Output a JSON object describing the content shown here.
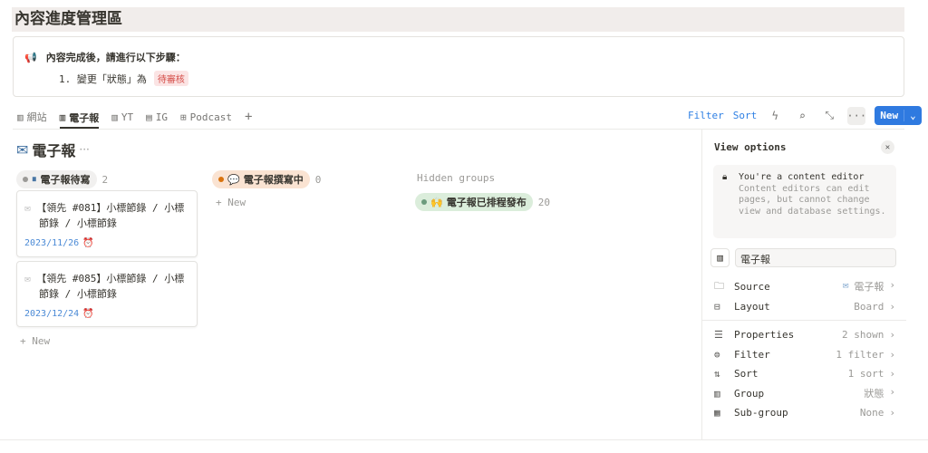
{
  "title": "內容進度管理區",
  "callout": {
    "icon": "megaphone-icon",
    "heading": "內容完成後，請進行以下步驟：",
    "step": "1. 變更「狀態」為",
    "tag": "待審核",
    "tag_color": "#d44c47"
  },
  "tabs": [
    {
      "label": "網站",
      "icon": "board-icon"
    },
    {
      "label": "電子報",
      "icon": "board-icon",
      "active": true
    },
    {
      "label": "YT",
      "icon": "board-icon"
    },
    {
      "label": "IG",
      "icon": "calendar-icon"
    },
    {
      "label": "Podcast",
      "icon": "table-icon"
    }
  ],
  "toolbar": {
    "filter": "Filter",
    "sort": "Sort",
    "new": "New",
    "accent": "#2f7ae0"
  },
  "board": {
    "title": "電子報",
    "more": "···",
    "groups": [
      {
        "label": "電子報待寫",
        "count": "2",
        "bg": "#f1f0ef",
        "dot": "#9b9a97",
        "emoji": "⏸"
      },
      {
        "label": "電子報撰寫中",
        "count": "0",
        "bg": "#fae3d2",
        "dot": "#d9730d",
        "emoji": "💬"
      }
    ],
    "cards": [
      {
        "title": "【領先 #081】小標節錄 / 小標節錄 / 小標節錄",
        "date": "2023/11/26"
      },
      {
        "title": "【領先 #085】小標節錄 / 小標節錄 / 小標節錄",
        "date": "2023/12/24"
      }
    ],
    "new_label": "+ New",
    "hidden_label": "Hidden groups",
    "hidden": {
      "label": "電子報已排程發布",
      "count": "20",
      "bg": "#dbeddb",
      "dot": "#6c9b7d",
      "emoji": "🙌"
    }
  },
  "panel": {
    "title": "View options",
    "notice_title": "You're a content editor",
    "notice_body": "Content editors can edit pages, but cannot change view and database settings.",
    "view_name": "電子報",
    "rows": [
      {
        "label": "Source",
        "value": "電子報",
        "icon": "folder-icon"
      },
      {
        "label": "Layout",
        "value": "Board",
        "icon": "layout-icon"
      },
      {
        "label": "Properties",
        "value": "2 shown",
        "icon": "list-icon"
      },
      {
        "label": "Filter",
        "value": "1 filter",
        "icon": "filter-icon"
      },
      {
        "label": "Sort",
        "value": "1 sort",
        "icon": "sort-icon"
      },
      {
        "label": "Group",
        "value": "狀態",
        "icon": "board-icon"
      },
      {
        "label": "Sub-group",
        "value": "None",
        "icon": "grid-icon"
      }
    ]
  }
}
